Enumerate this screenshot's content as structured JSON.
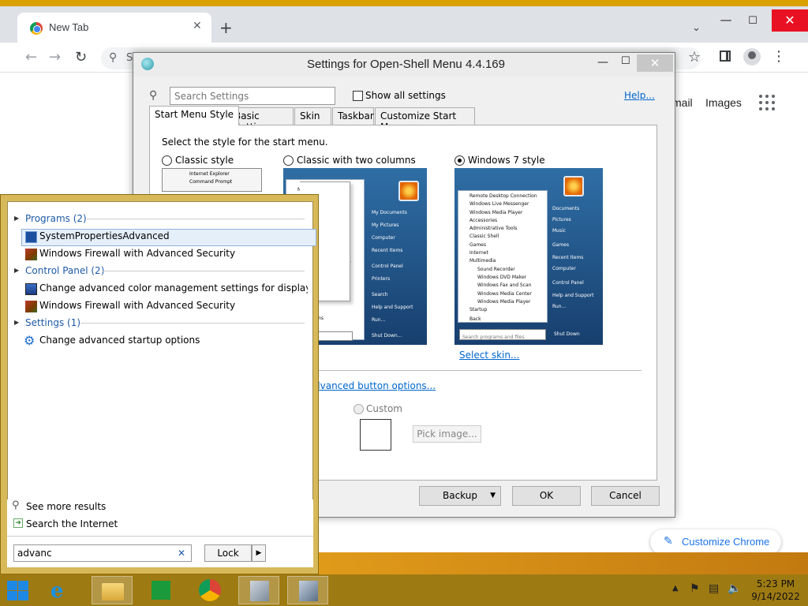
{
  "chrome": {
    "tab_title": "New Tab",
    "omnibox_text": "S",
    "gmail": "mail",
    "images": "Images",
    "customize": "Customize Chrome"
  },
  "dialog": {
    "title": "Settings for Open-Shell Menu 4.4.169",
    "search_placeholder": "Search Settings",
    "show_all": "Show all settings",
    "help": "Help...",
    "tabs": [
      "Start Menu Style",
      "Basic Settings",
      "Skin",
      "Taskbar",
      "Customize Start Menu"
    ],
    "prompt": "Select the style for the start menu.",
    "styles": [
      {
        "label": "Classic style",
        "selected": false
      },
      {
        "label": "Classic with two columns",
        "selected": false
      },
      {
        "label": "Windows 7 style",
        "selected": true
      }
    ],
    "select_skin": "Select skin...",
    "adv_button_options": "dvanced button options...",
    "custom": "Custom",
    "pick_image": "Pick image...",
    "backup": "Backup",
    "ok": "OK",
    "cancel": "Cancel",
    "preview_classic": [
      "Internet Explorer",
      "Command Prompt"
    ],
    "preview_two_left": [
      "Notepad",
      "or",
      "t Explorer",
      "and Prompt",
      "s Media Player",
      "ms"
    ],
    "preview_two_right": [
      "My Documents",
      "My Pictures",
      "Computer",
      "Recent Items",
      "Control Panel",
      "Printers",
      "Search",
      "Help and Support",
      "Run...",
      "Shut Down..."
    ],
    "preview_w7_left": [
      "Remote Desktop Connection",
      "Windows Live Messenger",
      "Windows Media Player",
      "Accessories",
      "Administrative Tools",
      "Classic Shell",
      "Games",
      "Internet",
      "Multimedia",
      "Sound Recorder",
      "Windows DVD Maker",
      "Windows Fax and Scan",
      "Windows Media Center",
      "Windows Media Player",
      "Startup",
      "Back"
    ],
    "preview_w7_right": [
      "Documents",
      "Pictures",
      "Music",
      "Games",
      "Recent Items",
      "Computer",
      "Control Panel",
      "Help and Support",
      "Run...",
      "Shut Down"
    ],
    "preview_w7_search": "Search programs and files"
  },
  "start_menu": {
    "groups": [
      {
        "label": "Programs (2)",
        "items": [
          "SystemPropertiesAdvanced",
          "Windows Firewall with Advanced Security"
        ]
      },
      {
        "label": "Control Panel (2)",
        "items": [
          "Change advanced color management settings for displays, sca...",
          "Windows Firewall with Advanced Security"
        ]
      },
      {
        "label": "Settings (1)",
        "items": [
          "Change advanced startup options"
        ]
      }
    ],
    "see_more": "See more results",
    "search_internet": "Search the Internet",
    "search_value": "advanc",
    "lock": "Lock"
  },
  "taskbar": {
    "time": "5:23 PM",
    "date": "9/14/2022"
  },
  "colors": {
    "start_menu_frame": "#d8b95a",
    "taskbar": "#9e7a12",
    "link": "#0066cc",
    "group_label": "#1e5aa6"
  }
}
